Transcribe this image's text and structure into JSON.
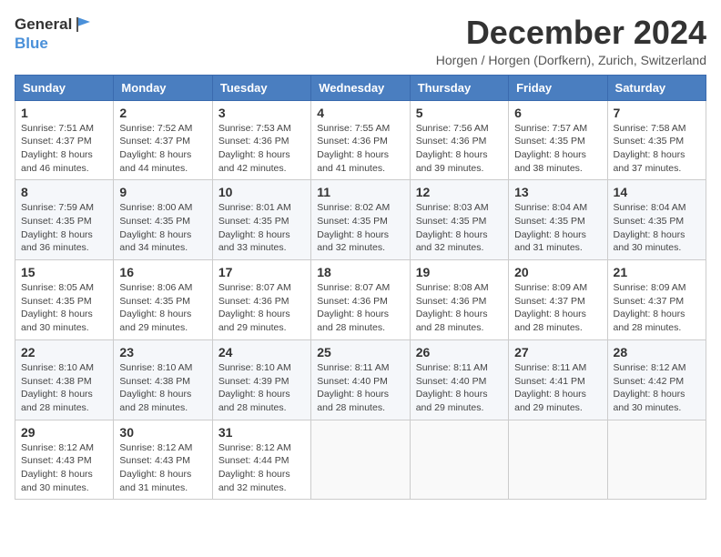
{
  "header": {
    "logo_general": "General",
    "logo_blue": "Blue",
    "month_title": "December 2024",
    "location": "Horgen / Horgen (Dorfkern), Zurich, Switzerland"
  },
  "weekdays": [
    "Sunday",
    "Monday",
    "Tuesday",
    "Wednesday",
    "Thursday",
    "Friday",
    "Saturday"
  ],
  "weeks": [
    [
      {
        "day": "1",
        "sunrise": "Sunrise: 7:51 AM",
        "sunset": "Sunset: 4:37 PM",
        "daylight": "Daylight: 8 hours and 46 minutes."
      },
      {
        "day": "2",
        "sunrise": "Sunrise: 7:52 AM",
        "sunset": "Sunset: 4:37 PM",
        "daylight": "Daylight: 8 hours and 44 minutes."
      },
      {
        "day": "3",
        "sunrise": "Sunrise: 7:53 AM",
        "sunset": "Sunset: 4:36 PM",
        "daylight": "Daylight: 8 hours and 42 minutes."
      },
      {
        "day": "4",
        "sunrise": "Sunrise: 7:55 AM",
        "sunset": "Sunset: 4:36 PM",
        "daylight": "Daylight: 8 hours and 41 minutes."
      },
      {
        "day": "5",
        "sunrise": "Sunrise: 7:56 AM",
        "sunset": "Sunset: 4:36 PM",
        "daylight": "Daylight: 8 hours and 39 minutes."
      },
      {
        "day": "6",
        "sunrise": "Sunrise: 7:57 AM",
        "sunset": "Sunset: 4:35 PM",
        "daylight": "Daylight: 8 hours and 38 minutes."
      },
      {
        "day": "7",
        "sunrise": "Sunrise: 7:58 AM",
        "sunset": "Sunset: 4:35 PM",
        "daylight": "Daylight: 8 hours and 37 minutes."
      }
    ],
    [
      {
        "day": "8",
        "sunrise": "Sunrise: 7:59 AM",
        "sunset": "Sunset: 4:35 PM",
        "daylight": "Daylight: 8 hours and 36 minutes."
      },
      {
        "day": "9",
        "sunrise": "Sunrise: 8:00 AM",
        "sunset": "Sunset: 4:35 PM",
        "daylight": "Daylight: 8 hours and 34 minutes."
      },
      {
        "day": "10",
        "sunrise": "Sunrise: 8:01 AM",
        "sunset": "Sunset: 4:35 PM",
        "daylight": "Daylight: 8 hours and 33 minutes."
      },
      {
        "day": "11",
        "sunrise": "Sunrise: 8:02 AM",
        "sunset": "Sunset: 4:35 PM",
        "daylight": "Daylight: 8 hours and 32 minutes."
      },
      {
        "day": "12",
        "sunrise": "Sunrise: 8:03 AM",
        "sunset": "Sunset: 4:35 PM",
        "daylight": "Daylight: 8 hours and 32 minutes."
      },
      {
        "day": "13",
        "sunrise": "Sunrise: 8:04 AM",
        "sunset": "Sunset: 4:35 PM",
        "daylight": "Daylight: 8 hours and 31 minutes."
      },
      {
        "day": "14",
        "sunrise": "Sunrise: 8:04 AM",
        "sunset": "Sunset: 4:35 PM",
        "daylight": "Daylight: 8 hours and 30 minutes."
      }
    ],
    [
      {
        "day": "15",
        "sunrise": "Sunrise: 8:05 AM",
        "sunset": "Sunset: 4:35 PM",
        "daylight": "Daylight: 8 hours and 30 minutes."
      },
      {
        "day": "16",
        "sunrise": "Sunrise: 8:06 AM",
        "sunset": "Sunset: 4:35 PM",
        "daylight": "Daylight: 8 hours and 29 minutes."
      },
      {
        "day": "17",
        "sunrise": "Sunrise: 8:07 AM",
        "sunset": "Sunset: 4:36 PM",
        "daylight": "Daylight: 8 hours and 29 minutes."
      },
      {
        "day": "18",
        "sunrise": "Sunrise: 8:07 AM",
        "sunset": "Sunset: 4:36 PM",
        "daylight": "Daylight: 8 hours and 28 minutes."
      },
      {
        "day": "19",
        "sunrise": "Sunrise: 8:08 AM",
        "sunset": "Sunset: 4:36 PM",
        "daylight": "Daylight: 8 hours and 28 minutes."
      },
      {
        "day": "20",
        "sunrise": "Sunrise: 8:09 AM",
        "sunset": "Sunset: 4:37 PM",
        "daylight": "Daylight: 8 hours and 28 minutes."
      },
      {
        "day": "21",
        "sunrise": "Sunrise: 8:09 AM",
        "sunset": "Sunset: 4:37 PM",
        "daylight": "Daylight: 8 hours and 28 minutes."
      }
    ],
    [
      {
        "day": "22",
        "sunrise": "Sunrise: 8:10 AM",
        "sunset": "Sunset: 4:38 PM",
        "daylight": "Daylight: 8 hours and 28 minutes."
      },
      {
        "day": "23",
        "sunrise": "Sunrise: 8:10 AM",
        "sunset": "Sunset: 4:38 PM",
        "daylight": "Daylight: 8 hours and 28 minutes."
      },
      {
        "day": "24",
        "sunrise": "Sunrise: 8:10 AM",
        "sunset": "Sunset: 4:39 PM",
        "daylight": "Daylight: 8 hours and 28 minutes."
      },
      {
        "day": "25",
        "sunrise": "Sunrise: 8:11 AM",
        "sunset": "Sunset: 4:40 PM",
        "daylight": "Daylight: 8 hours and 28 minutes."
      },
      {
        "day": "26",
        "sunrise": "Sunrise: 8:11 AM",
        "sunset": "Sunset: 4:40 PM",
        "daylight": "Daylight: 8 hours and 29 minutes."
      },
      {
        "day": "27",
        "sunrise": "Sunrise: 8:11 AM",
        "sunset": "Sunset: 4:41 PM",
        "daylight": "Daylight: 8 hours and 29 minutes."
      },
      {
        "day": "28",
        "sunrise": "Sunrise: 8:12 AM",
        "sunset": "Sunset: 4:42 PM",
        "daylight": "Daylight: 8 hours and 30 minutes."
      }
    ],
    [
      {
        "day": "29",
        "sunrise": "Sunrise: 8:12 AM",
        "sunset": "Sunset: 4:43 PM",
        "daylight": "Daylight: 8 hours and 30 minutes."
      },
      {
        "day": "30",
        "sunrise": "Sunrise: 8:12 AM",
        "sunset": "Sunset: 4:43 PM",
        "daylight": "Daylight: 8 hours and 31 minutes."
      },
      {
        "day": "31",
        "sunrise": "Sunrise: 8:12 AM",
        "sunset": "Sunset: 4:44 PM",
        "daylight": "Daylight: 8 hours and 32 minutes."
      },
      null,
      null,
      null,
      null
    ]
  ]
}
